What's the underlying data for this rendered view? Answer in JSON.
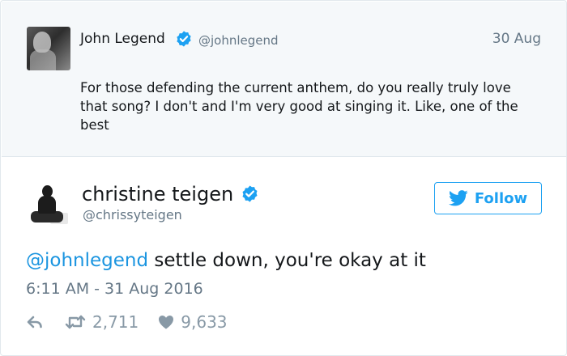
{
  "parent_tweet": {
    "name": "John Legend",
    "handle": "@johnlegend",
    "date": "30 Aug",
    "text": "For those defending the current anthem, do you really truly love that song? I don't and I'm very good at singing it. Like, one of the best",
    "verified_icon": "verified-badge-icon",
    "avatar": "avatar"
  },
  "main_tweet": {
    "name": "christine teigen",
    "handle": "@chrissyteigen",
    "follow_label": "Follow",
    "mention": "@johnlegend",
    "text": " settle down, you're okay at it",
    "timestamp": "6:11 AM - 31 Aug 2016",
    "retweets": "2,711",
    "likes": "9,633",
    "verified_icon": "verified-badge-icon",
    "follow_icon": "twitter-bird-icon",
    "reply_icon": "reply-icon",
    "retweet_icon": "retweet-icon",
    "like_icon": "heart-icon"
  },
  "colors": {
    "accent": "#1da1f2",
    "mention": "#1b95e0",
    "muted": "#657786",
    "parent_bg": "#f5f8fa"
  }
}
